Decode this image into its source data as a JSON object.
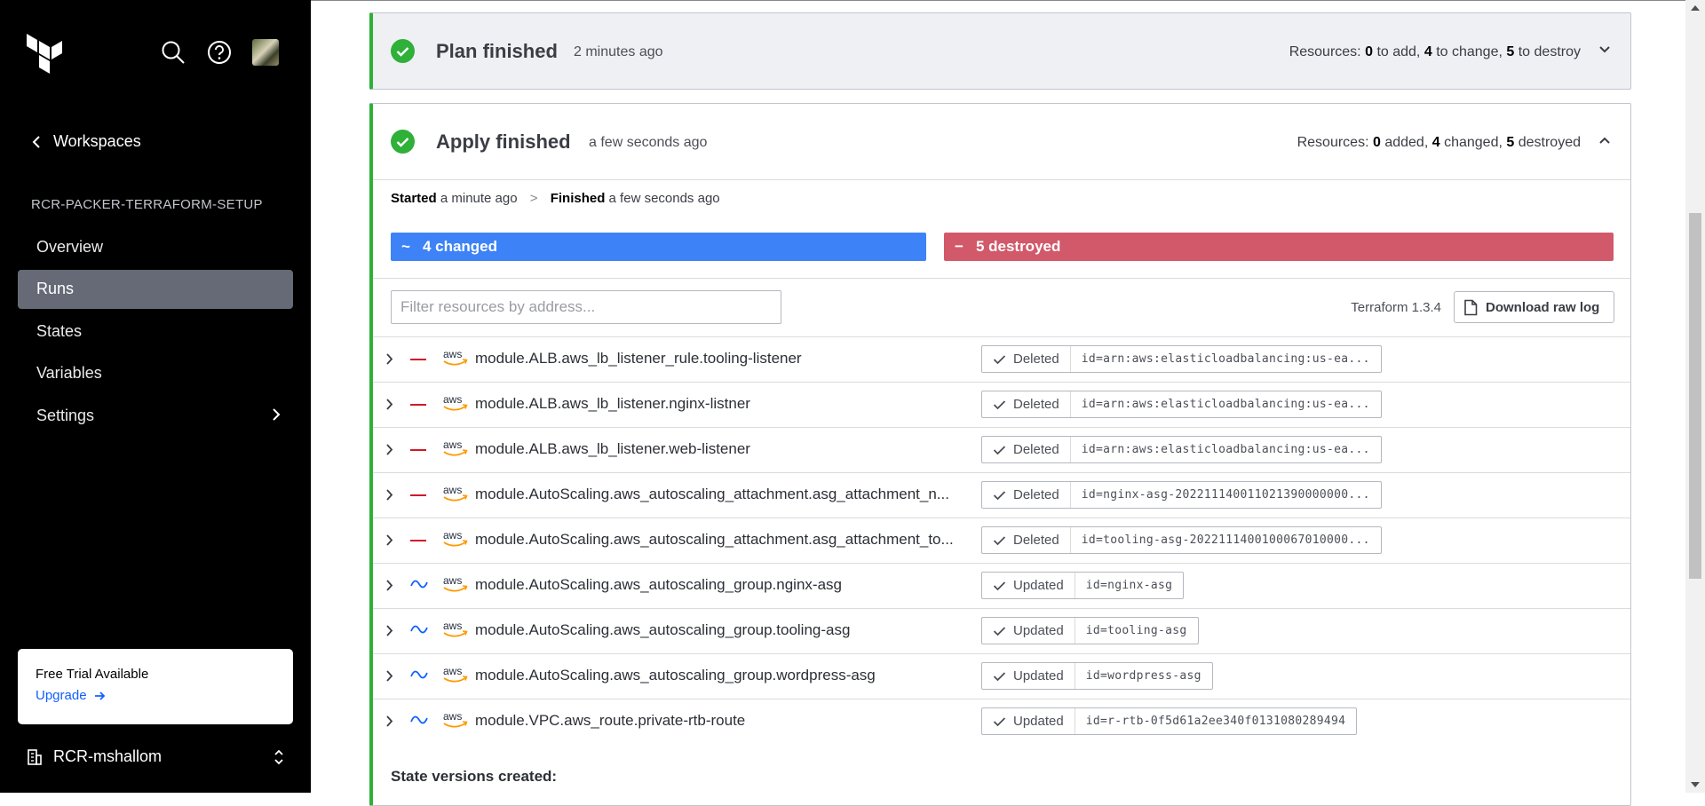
{
  "sidebar": {
    "back_label": "Workspaces",
    "workspace_name": "RCR-PACKER-TERRAFORM-SETUP",
    "nav": [
      {
        "label": "Overview",
        "active": false
      },
      {
        "label": "Runs",
        "active": true
      },
      {
        "label": "States",
        "active": false
      },
      {
        "label": "Variables",
        "active": false
      },
      {
        "label": "Settings",
        "active": false
      }
    ],
    "trial": {
      "title": "Free Trial Available",
      "link": "Upgrade"
    },
    "org_name": "RCR-mshallom"
  },
  "plan": {
    "title": "Plan finished",
    "time": "2 minutes ago",
    "summary": {
      "prefix": "Resources:",
      "add": "0",
      "add_label": "to add,",
      "change": "4",
      "change_label": "to change,",
      "destroy": "5",
      "destroy_label": "to destroy"
    }
  },
  "apply": {
    "title": "Apply finished",
    "time": "a few seconds ago",
    "summary": {
      "prefix": "Resources:",
      "added": "0",
      "added_label": "added,",
      "changed": "4",
      "changed_label": "changed,",
      "destroyed": "5",
      "destroyed_label": "destroyed"
    },
    "started_label": "Started",
    "started_time": "a minute ago",
    "separator": ">",
    "finished_label": "Finished",
    "finished_time": "a few seconds ago",
    "changed_bar": {
      "symbol": "~",
      "label": "4 changed"
    },
    "destroyed_bar": {
      "symbol": "−",
      "label": "5 destroyed"
    },
    "filter_placeholder": "Filter resources by address...",
    "terraform_version": "Terraform 1.3.4",
    "download_label": "Download raw log",
    "state_versions_label": "State versions created:"
  },
  "resources": [
    {
      "action": "delete",
      "provider": "aws",
      "address": "module.ALB.aws_lb_listener_rule.tooling-listener",
      "status": "Deleted",
      "id": "id=arn:aws:elasticloadbalancing:us-ea..."
    },
    {
      "action": "delete",
      "provider": "aws",
      "address": "module.ALB.aws_lb_listener.nginx-listner",
      "status": "Deleted",
      "id": "id=arn:aws:elasticloadbalancing:us-ea..."
    },
    {
      "action": "delete",
      "provider": "aws",
      "address": "module.ALB.aws_lb_listener.web-listener",
      "status": "Deleted",
      "id": "id=arn:aws:elasticloadbalancing:us-ea..."
    },
    {
      "action": "delete",
      "provider": "aws",
      "address": "module.AutoScaling.aws_autoscaling_attachment.asg_attachment_n...",
      "status": "Deleted",
      "id": "id=nginx-asg-202211140011021390000000..."
    },
    {
      "action": "delete",
      "provider": "aws",
      "address": "module.AutoScaling.aws_autoscaling_attachment.asg_attachment_to...",
      "status": "Deleted",
      "id": "id=tooling-asg-2022111400100067010000..."
    },
    {
      "action": "update",
      "provider": "aws",
      "address": "module.AutoScaling.aws_autoscaling_group.nginx-asg",
      "status": "Updated",
      "id": "id=nginx-asg"
    },
    {
      "action": "update",
      "provider": "aws",
      "address": "module.AutoScaling.aws_autoscaling_group.tooling-asg",
      "status": "Updated",
      "id": "id=tooling-asg"
    },
    {
      "action": "update",
      "provider": "aws",
      "address": "module.AutoScaling.aws_autoscaling_group.wordpress-asg",
      "status": "Updated",
      "id": "id=wordpress-asg"
    },
    {
      "action": "update",
      "provider": "aws",
      "address": "module.VPC.aws_route.private-rtb-route",
      "status": "Updated",
      "id": "id=r-rtb-0f5d61a2ee340f0131080289494"
    }
  ],
  "colors": {
    "success": "#2eb039",
    "changed": "#3d83f7",
    "destroyed": "#d1596a",
    "delete_mark": "#d1182a",
    "update_mark": "#1060ff"
  }
}
